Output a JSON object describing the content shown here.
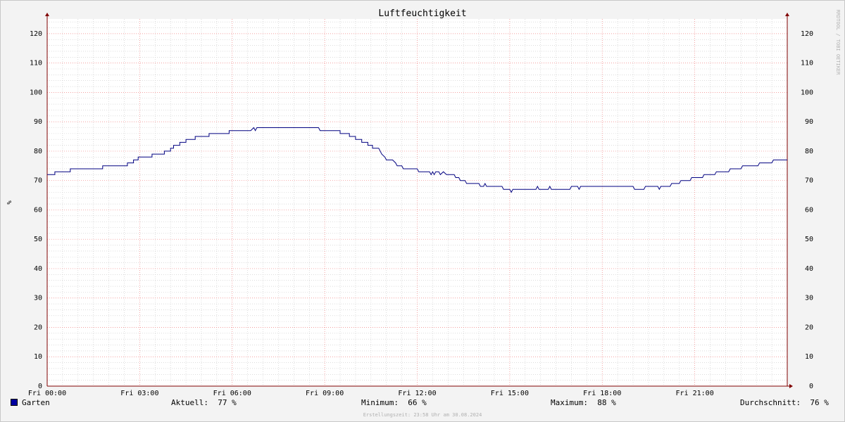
{
  "chart_data": {
    "type": "line",
    "title": "Luftfeuchtigkeit",
    "ylabel": "%",
    "watermark": "RRDTOOL / TOBI OETIKER",
    "x_tick_labels": [
      "Fri 00:00",
      "Fri 03:00",
      "Fri 06:00",
      "Fri 09:00",
      "Fri 12:00",
      "Fri 15:00",
      "Fri 18:00",
      "Fri 21:00"
    ],
    "y_ticks": [
      0,
      10,
      20,
      30,
      40,
      50,
      60,
      70,
      80,
      90,
      100,
      110,
      120
    ],
    "ylim": [
      0,
      125
    ],
    "xlim_hours": [
      0,
      24
    ],
    "grid": true,
    "series": [
      {
        "name": "Garten",
        "color": "#000080",
        "points": [
          [
            0.0,
            72
          ],
          [
            0.25,
            72
          ],
          [
            0.25,
            73
          ],
          [
            0.75,
            73
          ],
          [
            0.75,
            74
          ],
          [
            1.8,
            74
          ],
          [
            1.8,
            75
          ],
          [
            2.6,
            75
          ],
          [
            2.6,
            76
          ],
          [
            2.8,
            76
          ],
          [
            2.8,
            77
          ],
          [
            2.95,
            77
          ],
          [
            2.95,
            78
          ],
          [
            3.4,
            78
          ],
          [
            3.4,
            79
          ],
          [
            3.8,
            79
          ],
          [
            3.8,
            80
          ],
          [
            4.0,
            80
          ],
          [
            4.0,
            81
          ],
          [
            4.1,
            81
          ],
          [
            4.1,
            82
          ],
          [
            4.3,
            82
          ],
          [
            4.3,
            83
          ],
          [
            4.5,
            83
          ],
          [
            4.5,
            84
          ],
          [
            4.8,
            84
          ],
          [
            4.8,
            85
          ],
          [
            5.25,
            85
          ],
          [
            5.25,
            86
          ],
          [
            5.9,
            86
          ],
          [
            5.9,
            87
          ],
          [
            6.6,
            87
          ],
          [
            6.7,
            88
          ],
          [
            6.75,
            87
          ],
          [
            6.8,
            88
          ],
          [
            8.8,
            88
          ],
          [
            8.85,
            87
          ],
          [
            9.5,
            87
          ],
          [
            9.5,
            86
          ],
          [
            9.8,
            86
          ],
          [
            9.8,
            85
          ],
          [
            10.0,
            85
          ],
          [
            10.0,
            84
          ],
          [
            10.2,
            84
          ],
          [
            10.2,
            83
          ],
          [
            10.4,
            83
          ],
          [
            10.4,
            82
          ],
          [
            10.55,
            82
          ],
          [
            10.55,
            81
          ],
          [
            10.75,
            81
          ],
          [
            10.85,
            79
          ],
          [
            10.95,
            78
          ],
          [
            11.0,
            77
          ],
          [
            11.2,
            77
          ],
          [
            11.3,
            76
          ],
          [
            11.35,
            75
          ],
          [
            11.5,
            75
          ],
          [
            11.55,
            74
          ],
          [
            12.0,
            74
          ],
          [
            12.05,
            73
          ],
          [
            12.4,
            73
          ],
          [
            12.45,
            72
          ],
          [
            12.5,
            73
          ],
          [
            12.55,
            72
          ],
          [
            12.6,
            73
          ],
          [
            12.7,
            73
          ],
          [
            12.75,
            72
          ],
          [
            12.85,
            73
          ],
          [
            12.95,
            72
          ],
          [
            13.2,
            72
          ],
          [
            13.25,
            71
          ],
          [
            13.35,
            71
          ],
          [
            13.4,
            70
          ],
          [
            13.55,
            70
          ],
          [
            13.6,
            69
          ],
          [
            13.8,
            69
          ],
          [
            13.85,
            69
          ],
          [
            14.0,
            69
          ],
          [
            14.05,
            68
          ],
          [
            14.15,
            68
          ],
          [
            14.2,
            69
          ],
          [
            14.25,
            68
          ],
          [
            14.75,
            68
          ],
          [
            14.8,
            67
          ],
          [
            15.0,
            67
          ],
          [
            15.05,
            66
          ],
          [
            15.1,
            67
          ],
          [
            15.85,
            67
          ],
          [
            15.9,
            68
          ],
          [
            15.95,
            67
          ],
          [
            16.25,
            67
          ],
          [
            16.3,
            68
          ],
          [
            16.35,
            67
          ],
          [
            16.95,
            67
          ],
          [
            17.0,
            68
          ],
          [
            17.2,
            68
          ],
          [
            17.25,
            67
          ],
          [
            17.3,
            68
          ],
          [
            19.0,
            68
          ],
          [
            19.05,
            67
          ],
          [
            19.35,
            67
          ],
          [
            19.4,
            68
          ],
          [
            19.8,
            68
          ],
          [
            19.85,
            67
          ],
          [
            19.9,
            68
          ],
          [
            20.2,
            68
          ],
          [
            20.25,
            69
          ],
          [
            20.5,
            69
          ],
          [
            20.55,
            70
          ],
          [
            20.85,
            70
          ],
          [
            20.9,
            71
          ],
          [
            21.25,
            71
          ],
          [
            21.3,
            72
          ],
          [
            21.65,
            72
          ],
          [
            21.7,
            73
          ],
          [
            22.1,
            73
          ],
          [
            22.15,
            74
          ],
          [
            22.5,
            74
          ],
          [
            22.55,
            75
          ],
          [
            23.05,
            75
          ],
          [
            23.1,
            76
          ],
          [
            23.5,
            76
          ],
          [
            23.55,
            77
          ],
          [
            24.0,
            77
          ]
        ]
      }
    ]
  },
  "legend": {
    "series_name": "Garten",
    "current_label": "Aktuell:",
    "current_value": "77 %",
    "min_label": "Minimum:",
    "min_value": "66 %",
    "max_label": "Maximum:",
    "max_value": "88 %",
    "avg_label": "Durchschnitt:",
    "avg_value": "76 %"
  },
  "created": "Erstellungszeit: 23:58 Uhr am 30.08.2024",
  "colors": {
    "series": "#000080",
    "major_grid": "#f08080",
    "minor_grid": "#c8c8c8",
    "axis": "#800000"
  }
}
